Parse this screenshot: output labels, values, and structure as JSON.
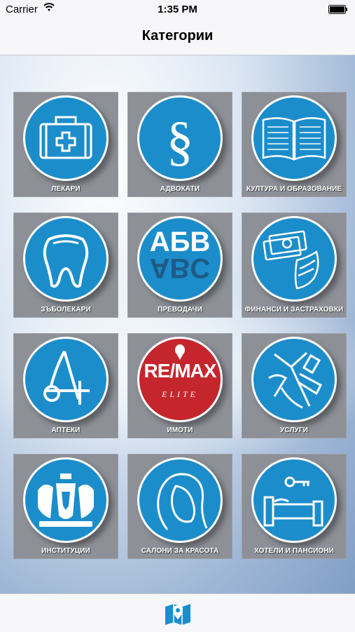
{
  "status_bar": {
    "carrier": "Carrier",
    "time": "1:35 PM"
  },
  "nav": {
    "title": "Категории"
  },
  "colors": {
    "tile": "#8d9097",
    "circle": "#1c8dcb",
    "remax": "#c5262d"
  },
  "categories": [
    {
      "label": "ЛЕКАРИ",
      "icon": "medical-kit-icon"
    },
    {
      "label": "АДВОКАТИ",
      "icon": "section-sign-icon"
    },
    {
      "label": "КУЛТУРА И ОБРАЗОВАНИЕ",
      "icon": "book-icon"
    },
    {
      "label": "ЗЪБОЛЕКАРИ",
      "icon": "tooth-icon"
    },
    {
      "label": "ПРЕВОДАЧИ",
      "icon": "translation-icon",
      "logo_text_top": "АБВ",
      "logo_text_bottom": "ABC"
    },
    {
      "label": "ФИНАНСИ И ЗАСТРАХОВКИ",
      "icon": "money-shield-icon"
    },
    {
      "label": "АПТЕКИ",
      "icon": "pharmacy-icon"
    },
    {
      "label": "ИМОТИ",
      "icon": "remax-logo-icon",
      "logo_text": "RE/MAX",
      "logo_sub": "ELITE"
    },
    {
      "label": "УСЛУГИ",
      "icon": "tools-icon"
    },
    {
      "label": "ИНСТИТУЦИИ",
      "icon": "coat-of-arms-icon"
    },
    {
      "label": "САЛОНИ ЗА КРАСОТА",
      "icon": "woman-profile-icon"
    },
    {
      "label": "ХОТЕЛИ И ПАНСИОНИ",
      "icon": "bed-key-icon"
    }
  ],
  "tab_bar": {
    "icon": "map-pin-icon"
  }
}
